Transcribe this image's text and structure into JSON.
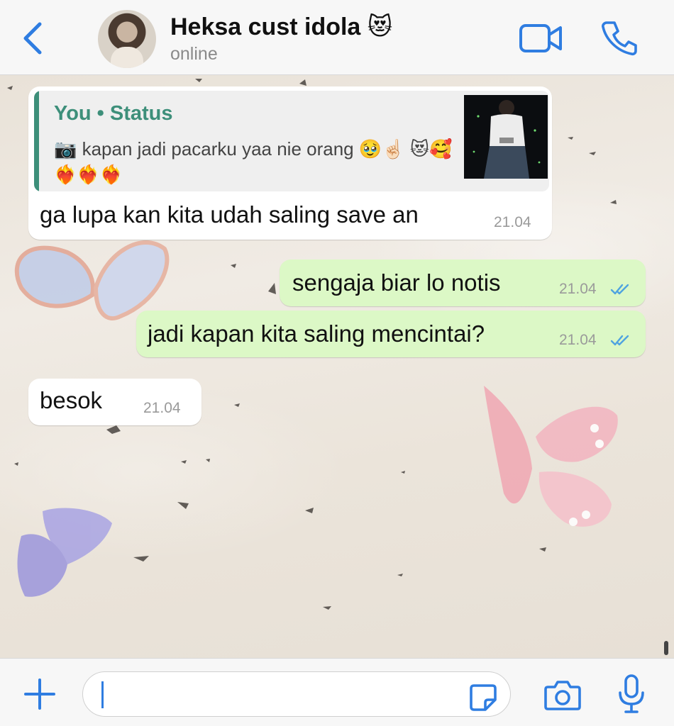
{
  "header": {
    "contact_name": "Heksa cust idola 😻",
    "contact_status": "online",
    "back_icon": "chevron-left-icon",
    "video_icon": "video-camera-icon",
    "call_icon": "phone-icon"
  },
  "messages": [
    {
      "direction": "incoming",
      "quote": {
        "author": "You • Status",
        "text": "📷 kapan jadi pacarku yaa nie orang 🥹☝🏻 😻🥰❤️‍🔥❤️‍🔥❤️‍🔥"
      },
      "text": "ga lupa kan kita udah saling save an",
      "time": "21.04"
    },
    {
      "direction": "outgoing",
      "text": "sengaja biar lo notis",
      "time": "21.04",
      "read": true
    },
    {
      "direction": "outgoing",
      "text": "jadi kapan kita saling mencintai?",
      "time": "21.04",
      "read": true
    },
    {
      "direction": "incoming",
      "text": "besok",
      "time": "21.04"
    }
  ],
  "input_bar": {
    "plus_icon": "plus-icon",
    "message_value": "",
    "sticker_icon": "sticker-icon",
    "camera_icon": "camera-icon",
    "mic_icon": "microphone-icon"
  },
  "colors": {
    "accent": "#2f7de1",
    "outgoing_bubble": "#dcf8c6",
    "incoming_bubble": "#ffffff",
    "quote_accent": "#3d8f7a",
    "read_ticks": "#4fa3e0"
  }
}
